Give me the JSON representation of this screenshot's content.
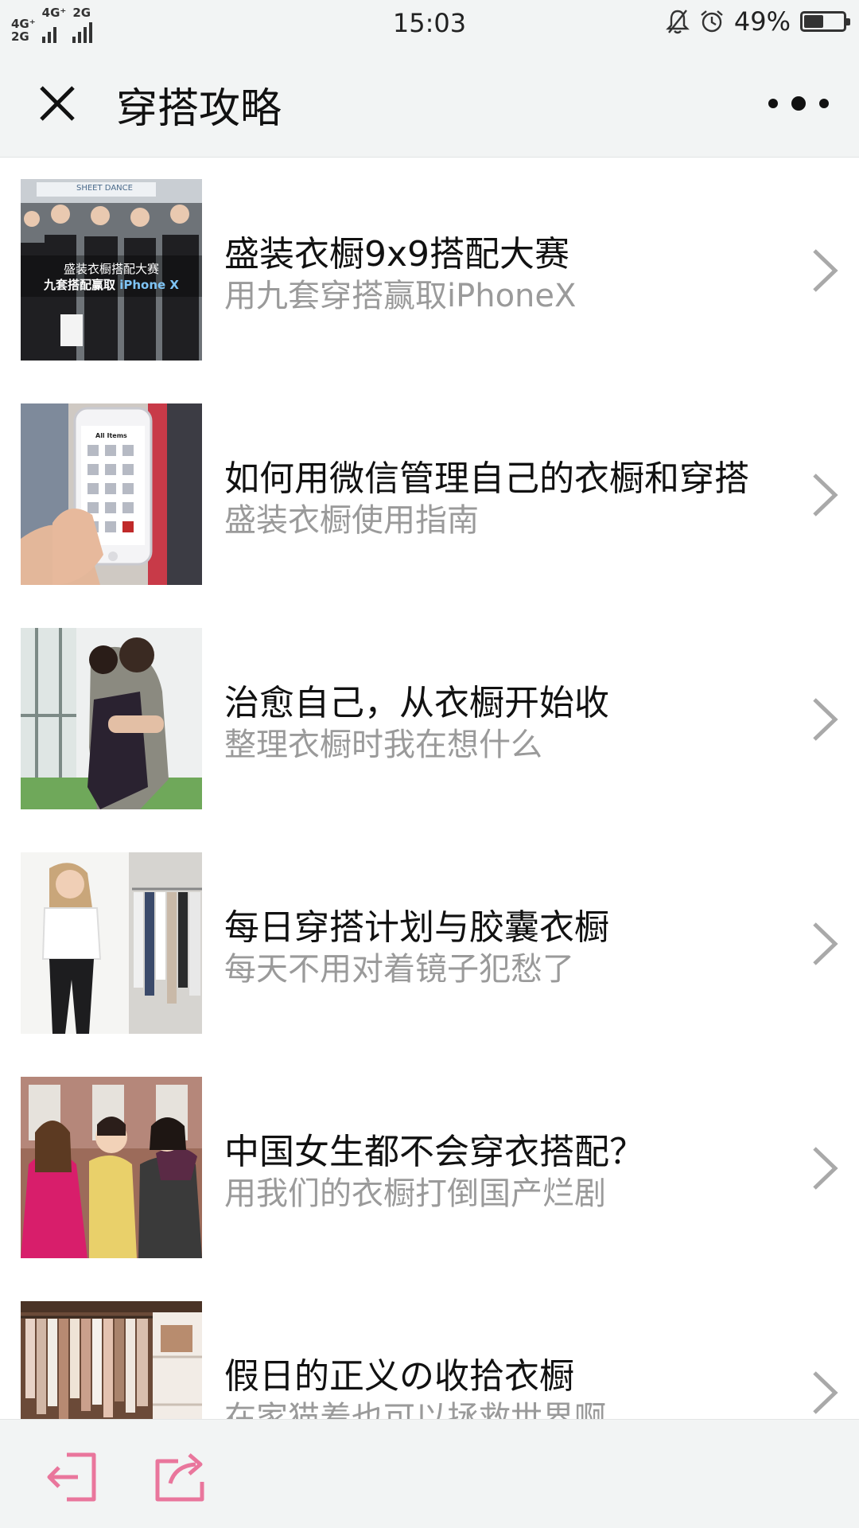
{
  "status_bar": {
    "network_1": "4G⁺",
    "network_1b": "2G",
    "network_2": "4G⁺",
    "network_3": "2G",
    "time": "15:03",
    "battery_percent": "49%",
    "battery_level": 0.49,
    "icons": [
      "bell-muted-icon",
      "alarm-clock-icon",
      "battery-icon"
    ]
  },
  "nav": {
    "title": "穿搭攻略",
    "close_icon": "close-icon",
    "more_icon": "more-dots-icon"
  },
  "articles": [
    {
      "title": "盛装衣橱9x9搭配大赛",
      "subtitle": "用九套穿搭赢取iPhoneX",
      "thumb_caption_1": "盛装衣橱搭配大赛",
      "thumb_caption_2": "九套搭配赢取 ",
      "thumb_caption_3": "iPhone X",
      "thumb_banner": "SHEET DANCE"
    },
    {
      "title": "如何用微信管理自己的衣橱和穿搭",
      "subtitle": "盛装衣橱使用指南",
      "thumb_phone_label": "All Items"
    },
    {
      "title": "治愈自己，从衣橱开始收",
      "subtitle": "整理衣橱时我在想什么"
    },
    {
      "title": "每日穿搭计划与胶囊衣橱",
      "subtitle": "每天不用对着镜子犯愁了"
    },
    {
      "title": "中国女生都不会穿衣搭配？",
      "subtitle": "用我们的衣橱打倒国产烂剧"
    },
    {
      "title": "假日的正义の收拾衣橱",
      "subtitle": "在家猫着也可以拯救世界啊"
    }
  ],
  "bottom_bar": {
    "accent_color": "#e9769c",
    "icons": [
      "exit-icon",
      "share-icon"
    ]
  }
}
